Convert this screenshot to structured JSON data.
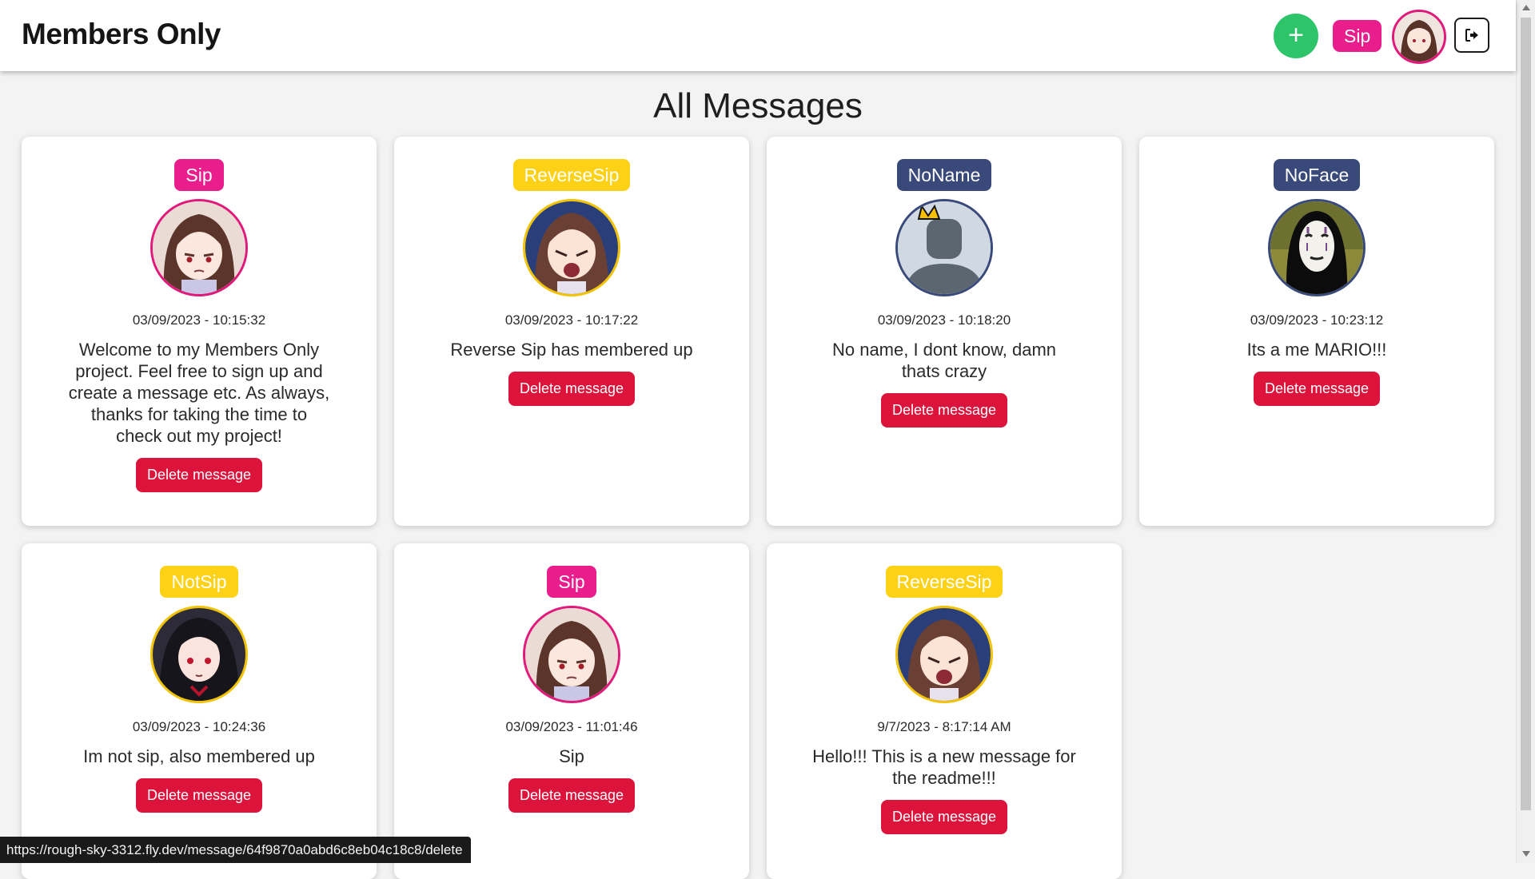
{
  "header": {
    "title": "Members Only",
    "add_label": "+",
    "user_name": "Sip",
    "user_badge_color": "#e91e8c",
    "add_button_color": "#2ec56a",
    "logout_icon": "logout-icon"
  },
  "main": {
    "title": "All Messages"
  },
  "badge_colors": {
    "pink": "#e91e8c",
    "yellow": "#fcd116",
    "navy": "#394a7a"
  },
  "delete_button_color": "#dc143c",
  "messages": [
    {
      "author": "Sip",
      "badge_color": "#e91e8c",
      "avatar": "brown-hair-girl-annoyed",
      "border": "#e0197a",
      "timestamp": "03/09/2023 - 10:15:32",
      "text": "Welcome to my Members Only project. Feel free to sign up and create a message etc. As always, thanks for taking the time to check out my project!",
      "delete_label": "Delete message"
    },
    {
      "author": "ReverseSip",
      "badge_color": "#fcd116",
      "avatar": "brown-hair-girl-crying",
      "border": "#f2c300",
      "timestamp": "03/09/2023 - 10:17:22",
      "text": "Reverse Sip has membered up",
      "delete_label": "Delete message"
    },
    {
      "author": "NoName",
      "badge_color": "#394a7a",
      "avatar": "default-user-crown",
      "border": "#394a7a",
      "timestamp": "03/09/2023 - 10:18:20",
      "text": "No name, I dont know, damn thats crazy",
      "delete_label": "Delete message"
    },
    {
      "author": "NoFace",
      "badge_color": "#394a7a",
      "avatar": "no-face-mask",
      "border": "#394a7a",
      "timestamp": "03/09/2023 - 10:23:12",
      "text": "Its a me MARIO!!!",
      "delete_label": "Delete message"
    },
    {
      "author": "NotSip",
      "badge_color": "#fcd116",
      "avatar": "black-hair-girl",
      "border": "#f2c300",
      "timestamp": "03/09/2023 - 10:24:36",
      "text": "Im not sip, also membered up",
      "delete_label": "Delete message"
    },
    {
      "author": "Sip",
      "badge_color": "#e91e8c",
      "avatar": "brown-hair-girl-annoyed",
      "border": "#e0197a",
      "timestamp": "03/09/2023 - 11:01:46",
      "text": "Sip",
      "delete_label": "Delete message"
    },
    {
      "author": "ReverseSip",
      "badge_color": "#fcd116",
      "avatar": "brown-hair-girl-crying",
      "border": "#f2c300",
      "timestamp": "9/7/2023 - 8:17:14 AM",
      "text": "Hello!!! This is a new message for the readme!!!",
      "delete_label": "Delete message"
    }
  ],
  "status_bar": {
    "url": "https://rough-sky-3312.fly.dev/message/64f9870a0abd6c8eb04c18c8/delete"
  }
}
